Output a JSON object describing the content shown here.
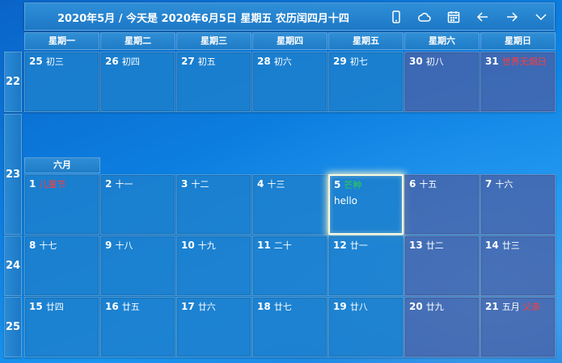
{
  "header": {
    "title": "2020年5月 / 今天是 2020年6月5日 星期五 农历闰四月十四",
    "buttons": [
      {
        "name": "mobile-icon"
      },
      {
        "name": "cloud-icon"
      },
      {
        "name": "calendar-icon"
      },
      {
        "name": "arrow-left-icon"
      },
      {
        "name": "arrow-right-icon"
      },
      {
        "name": "chevron-down-icon"
      }
    ]
  },
  "weekdays": [
    "星期一",
    "星期二",
    "星期三",
    "星期四",
    "星期五",
    "星期六",
    "星期日"
  ],
  "weeks": [
    "22",
    "23",
    "24",
    "25"
  ],
  "month_label": "六月",
  "rows": [
    [
      {
        "d": "25",
        "l": "初三"
      },
      {
        "d": "26",
        "l": "初四"
      },
      {
        "d": "27",
        "l": "初五"
      },
      {
        "d": "28",
        "l": "初六"
      },
      {
        "d": "29",
        "l": "初七"
      },
      {
        "d": "30",
        "l": "初八",
        "weekend": true
      },
      {
        "d": "31",
        "l": "世界无烟日",
        "red": true,
        "weekend": true
      }
    ],
    [
      {
        "d": "1",
        "l": "儿童节",
        "red": true
      },
      {
        "d": "2",
        "l": "十一"
      },
      {
        "d": "3",
        "l": "十二"
      },
      {
        "d": "4",
        "l": "十三"
      },
      {
        "d": "5",
        "l": "芒种",
        "green": true,
        "today": true,
        "note": "hello"
      },
      {
        "d": "6",
        "l": "十五",
        "weekend": true
      },
      {
        "d": "7",
        "l": "十六",
        "weekend": true
      }
    ],
    [
      {
        "d": "8",
        "l": "十七"
      },
      {
        "d": "9",
        "l": "十八"
      },
      {
        "d": "10",
        "l": "十九"
      },
      {
        "d": "11",
        "l": "二十"
      },
      {
        "d": "12",
        "l": "廿一"
      },
      {
        "d": "13",
        "l": "廿二",
        "weekend": true
      },
      {
        "d": "14",
        "l": "廿三",
        "weekend": true
      }
    ],
    [
      {
        "d": "15",
        "l": "廿四"
      },
      {
        "d": "16",
        "l": "廿五"
      },
      {
        "d": "17",
        "l": "廿六"
      },
      {
        "d": "18",
        "l": "廿七"
      },
      {
        "d": "19",
        "l": "廿八"
      },
      {
        "d": "20",
        "l": "廿九",
        "weekend": true
      },
      {
        "d": "21",
        "l": "五月 父亲",
        "red_partial": true,
        "weekend": true
      }
    ]
  ]
}
